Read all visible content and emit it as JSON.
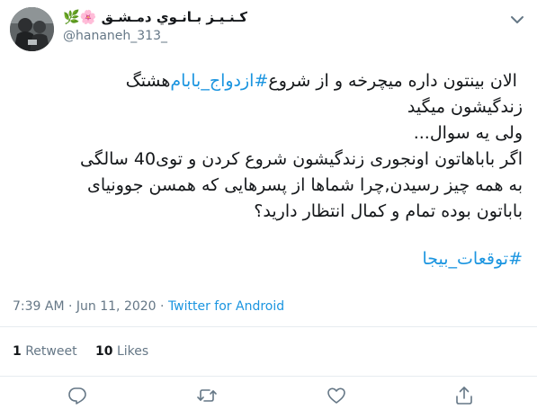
{
  "author": {
    "display_name": "كـنـيـز بـانـوي دمـشـق 🌸🌿",
    "handle": "@hananeh_313_"
  },
  "tweet": {
    "line1_pre": "هشتگ ",
    "line1_hashtag": "#ازدواج_بابام",
    "line1_post": " الان بینتون داره میچرخه و از شروع",
    "line2": "زندگیشون میگید",
    "line3": "ولی یه سوال...",
    "line4": "اگر باباهاتون اونجوری زندگیشون شروع کردن و توی40 سالگی",
    "line5": "به همه چیز رسیدن,چرا شماها از پسرهایی که همسن جوونیای",
    "line6": "باباتون بوده تمام و کمال انتظار دارید؟",
    "hashtag2": "#توقعات_بیجا"
  },
  "meta": {
    "time": "7:39 AM",
    "separator": " · ",
    "date": "Jun 11, 2020",
    "source": "Twitter for Android"
  },
  "stats": {
    "retweets_count": "1",
    "retweets_label": "Retweet",
    "likes_count": "10",
    "likes_label": "Likes"
  },
  "icons": {
    "more": "chevron-down-icon",
    "reply": "reply-icon",
    "retweet": "retweet-icon",
    "like": "heart-icon",
    "share": "share-icon"
  },
  "colors": {
    "link": "#1b95e0",
    "secondary_text": "#657786",
    "primary_text": "#14171a",
    "divider": "#e6ecf0"
  }
}
